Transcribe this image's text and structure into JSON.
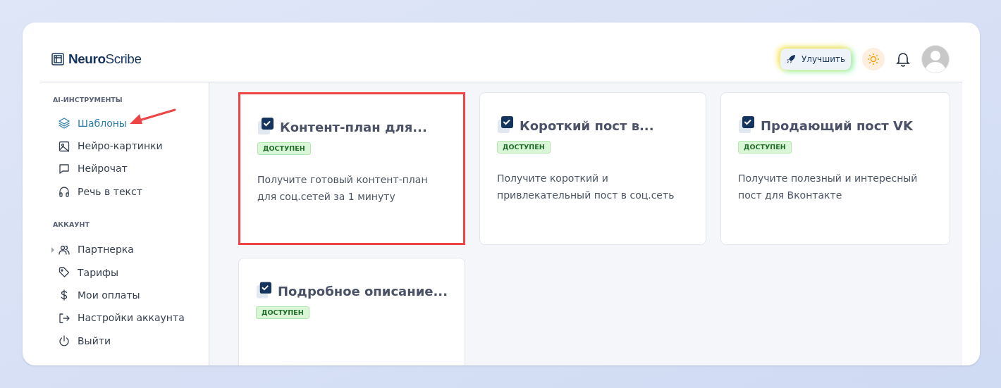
{
  "logo": {
    "bold": "Neuro",
    "light": "Scribe"
  },
  "header": {
    "upgrade_button": "Улучшить"
  },
  "sidebar": {
    "sections": [
      {
        "heading": "AI-ИНСТРУМЕНТЫ",
        "items": [
          {
            "label": "Шаблоны",
            "kind": "layers",
            "selected": true,
            "arrow": true,
            "expandable": false
          },
          {
            "label": "Нейро-картинки",
            "kind": "image",
            "selected": false,
            "arrow": false,
            "expandable": false
          },
          {
            "label": "Нейрочат",
            "kind": "chat",
            "selected": false,
            "arrow": false,
            "expandable": false
          },
          {
            "label": "Речь в текст",
            "kind": "headphones",
            "selected": false,
            "arrow": false,
            "expandable": false
          }
        ]
      },
      {
        "heading": "АККАУНТ",
        "items": [
          {
            "label": "Партнерка",
            "kind": "users",
            "selected": false,
            "arrow": false,
            "expandable": true
          },
          {
            "label": "Тарифы",
            "kind": "tag",
            "selected": false,
            "arrow": false,
            "expandable": false
          },
          {
            "label": "Мои оплаты",
            "kind": "dollar",
            "selected": false,
            "arrow": false,
            "expandable": false
          },
          {
            "label": "Настройки аккаунта",
            "kind": "logout",
            "selected": false,
            "arrow": false,
            "expandable": false
          },
          {
            "label": "Выйти",
            "kind": "power",
            "selected": false,
            "arrow": false,
            "expandable": false
          }
        ]
      }
    ]
  },
  "cards": [
    {
      "title": "Контент-план для...",
      "badge": "ДОСТУПЕН",
      "description": "Получите готовый контент-план для соц.сетей за 1 минуту",
      "highlighted": true
    },
    {
      "title": "Короткий пост в...",
      "badge": "ДОСТУПЕН",
      "description": "Получите короткий и привлекательный пост в соц.сеть",
      "highlighted": false
    },
    {
      "title": "Продающий пост VK",
      "badge": "ДОСТУПЕН",
      "description": "Получите полезный и интересный пост для Вконтакте",
      "highlighted": false
    },
    {
      "title": "Подробное описание...",
      "badge": "ДОСТУПЕН",
      "highlighted": false
    }
  ]
}
